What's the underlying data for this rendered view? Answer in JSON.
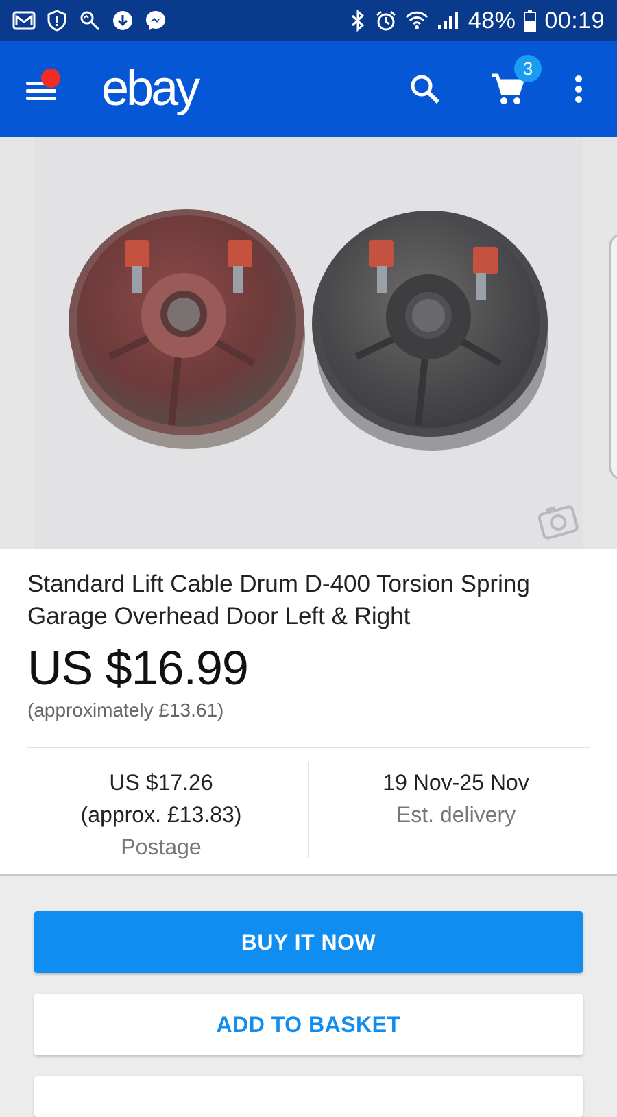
{
  "status_bar": {
    "notification_icons": [
      "mail-icon",
      "shield-icon",
      "search-alert-icon",
      "download-icon",
      "messenger-icon"
    ],
    "system_icons": [
      "bluetooth-icon",
      "alarm-icon",
      "wifi-icon",
      "signal-icon",
      "battery-icon"
    ],
    "battery": "48%",
    "time": "00:19"
  },
  "app_bar": {
    "logo": "ebay",
    "cart_count": "3",
    "icons": [
      "menu-icon",
      "search-icon",
      "cart-icon",
      "more-vert-icon"
    ],
    "colors": {
      "background": "#0557d6",
      "badge": "#1a9cf2",
      "menu_dot": "#f02d24"
    }
  },
  "product": {
    "title": "Standard Lift Cable Drum D-400 Torsion Spring Garage Overhead Door Left & Right",
    "price": "US $16.99",
    "price_approx": "(approximately £13.61)",
    "postage": {
      "amount": "US $17.26",
      "approx": "(approx. £13.83)",
      "label": "Postage"
    },
    "delivery": {
      "dates": "19 Nov-25 Nov",
      "label": "Est. delivery"
    }
  },
  "actions": {
    "buy_now": "BUY IT NOW",
    "add_to_basket": "ADD TO BASKET",
    "colors": {
      "primary": "#0f8df0"
    }
  }
}
